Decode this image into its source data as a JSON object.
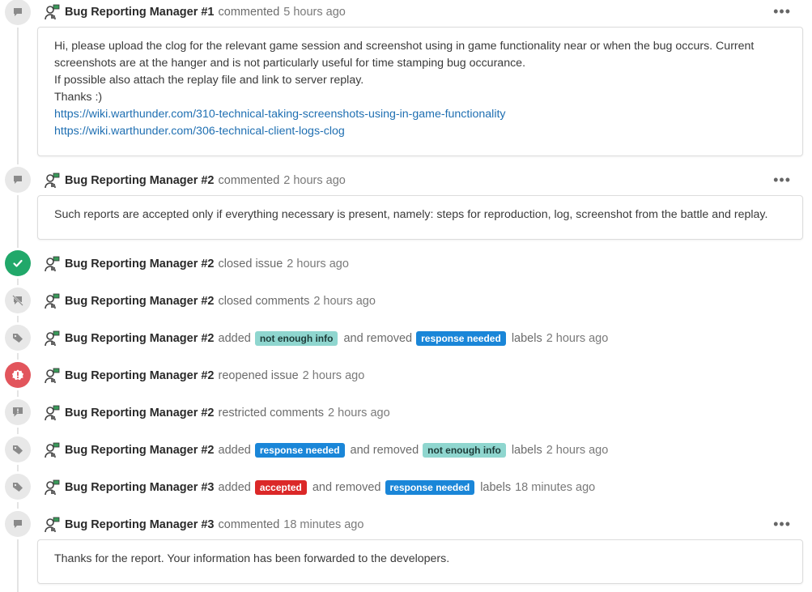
{
  "colors": {
    "label_teal": "#8fd6cf",
    "label_blue": "#1a86d8",
    "label_red": "#db2828",
    "closed_green": "#21a86a",
    "reopen_red": "#e2555c",
    "link": "#1f6fb2"
  },
  "events": [
    {
      "icon": "comment-icon",
      "author": "Bug Reporting Manager #1",
      "action": "commented",
      "time": "5 hours ago",
      "comment": {
        "lines": [
          "Hi, please upload the clog for the relevant game session and screenshot using in game functionality near or when the bug occurs. Current screenshots are at the hanger and is not particularly useful for time stamping bug occurance.",
          "If possible also attach the replay file and link to server replay.",
          "Thanks :)"
        ],
        "links": [
          "https://wiki.warthunder.com/310-technical-taking-screenshots-using-in-game-functionality",
          "https://wiki.warthunder.com/306-technical-client-logs-clog"
        ]
      }
    },
    {
      "icon": "comment-icon",
      "author": "Bug Reporting Manager #2",
      "action": "commented",
      "time": "2 hours ago",
      "comment": {
        "lines": [
          "Such reports are accepted only if everything necessary is present, namely: steps for reproduction, log, screenshot from the battle and replay."
        ]
      }
    },
    {
      "icon": "check-circle-icon",
      "author": "Bug Reporting Manager #2",
      "action": "closed issue",
      "time": "2 hours ago"
    },
    {
      "icon": "comment-off-icon",
      "author": "Bug Reporting Manager #2",
      "action": "closed comments",
      "time": "2 hours ago"
    },
    {
      "icon": "tag-icon",
      "author": "Bug Reporting Manager #2",
      "action": "added",
      "added_label": "not enough info",
      "middle": "and removed",
      "removed_label": "response needed",
      "suffix": "labels",
      "time": "2 hours ago"
    },
    {
      "icon": "reopen-alert-icon",
      "author": "Bug Reporting Manager #2",
      "action": "reopened issue",
      "time": "2 hours ago"
    },
    {
      "icon": "restricted-comment-icon",
      "author": "Bug Reporting Manager #2",
      "action": "restricted comments",
      "time": "2 hours ago"
    },
    {
      "icon": "tag-icon",
      "author": "Bug Reporting Manager #2",
      "action": "added",
      "added_label": "response needed",
      "middle": "and removed",
      "removed_label": "not enough info",
      "suffix": "labels",
      "time": "2 hours ago"
    },
    {
      "icon": "tag-icon",
      "author": "Bug Reporting Manager #3",
      "action": "added",
      "added_label": "accepted",
      "middle": "and removed",
      "removed_label": "response needed",
      "suffix": "labels",
      "time": "18 minutes ago"
    },
    {
      "icon": "comment-icon",
      "author": "Bug Reporting Manager #3",
      "action": "commented",
      "time": "18 minutes ago",
      "comment": {
        "lines": [
          "Thanks for the report. Your information has been forwarded to the developers."
        ]
      }
    }
  ]
}
